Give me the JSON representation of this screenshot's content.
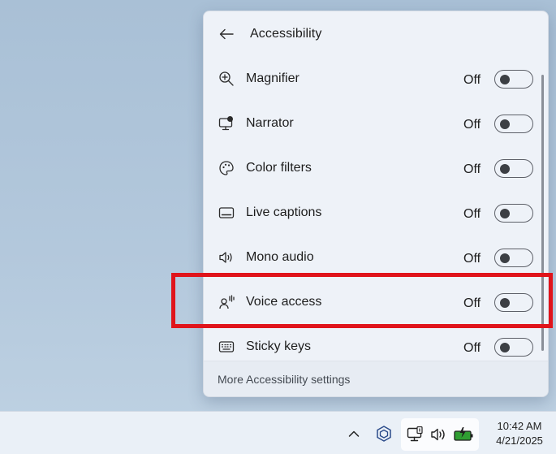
{
  "panel": {
    "title": "Accessibility",
    "items": [
      {
        "label": "Magnifier",
        "state": "Off",
        "icon": "magnifier-icon"
      },
      {
        "label": "Narrator",
        "state": "Off",
        "icon": "narrator-icon"
      },
      {
        "label": "Color filters",
        "state": "Off",
        "icon": "color-filters-icon"
      },
      {
        "label": "Live captions",
        "state": "Off",
        "icon": "live-captions-icon"
      },
      {
        "label": "Mono audio",
        "state": "Off",
        "icon": "mono-audio-icon"
      },
      {
        "label": "Voice access",
        "state": "Off",
        "icon": "voice-access-icon"
      },
      {
        "label": "Sticky keys",
        "state": "Off",
        "icon": "sticky-keys-icon"
      }
    ],
    "footer_link": "More Accessibility settings"
  },
  "taskbar": {
    "time": "10:42 AM",
    "date": "4/21/2025"
  },
  "colors": {
    "highlight": "#e0141b",
    "panel_bg": "#eef2f8",
    "taskbar_bg": "#eaf0f7",
    "battery_green": "#2f9e32"
  }
}
